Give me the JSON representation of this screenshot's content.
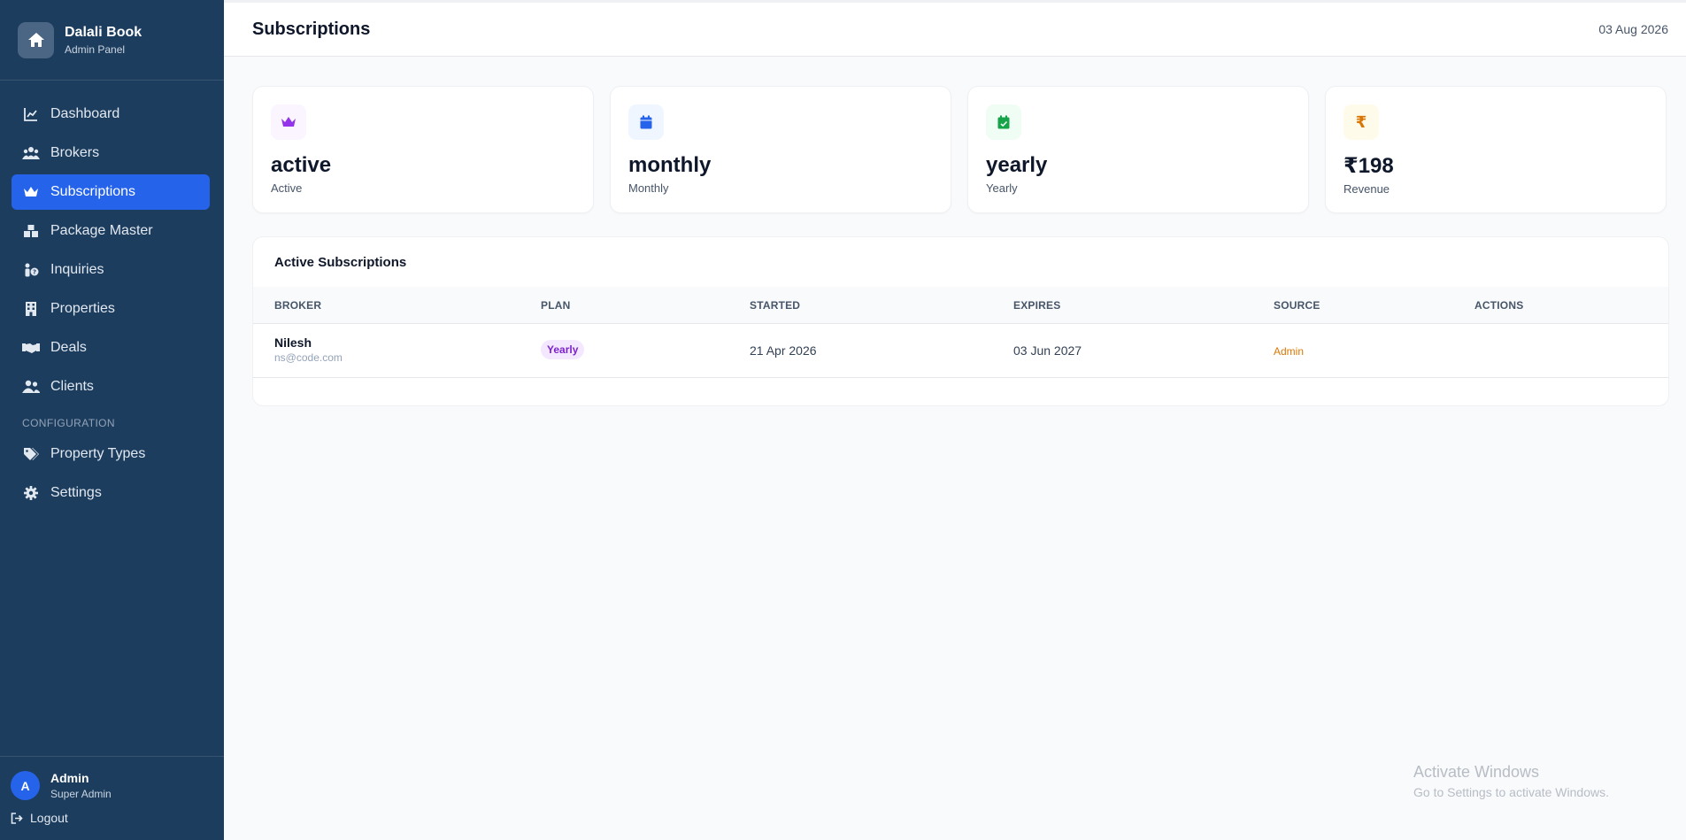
{
  "brand": {
    "title": "Dalali Book",
    "subtitle": "Admin Panel"
  },
  "sidebar": {
    "items": [
      {
        "label": "Dashboard",
        "icon": "chart-line-icon"
      },
      {
        "label": "Brokers",
        "icon": "users-icon"
      },
      {
        "label": "Subscriptions",
        "icon": "crown-icon",
        "active": true
      },
      {
        "label": "Package Master",
        "icon": "boxes-icon"
      },
      {
        "label": "Inquiries",
        "icon": "person-question-icon"
      },
      {
        "label": "Properties",
        "icon": "building-icon"
      },
      {
        "label": "Deals",
        "icon": "handshake-icon"
      },
      {
        "label": "Clients",
        "icon": "user-group-icon"
      }
    ],
    "section_label": "CONFIGURATION",
    "config_items": [
      {
        "label": "Property Types",
        "icon": "tags-icon"
      },
      {
        "label": "Settings",
        "icon": "gear-icon"
      }
    ]
  },
  "user": {
    "initial": "A",
    "name": "Admin",
    "role": "Super Admin",
    "logout_label": "Logout"
  },
  "header": {
    "title": "Subscriptions",
    "date": "03 Aug 2026"
  },
  "stats": [
    {
      "value": "active",
      "label": "Active",
      "icon": "crown-icon",
      "color": "#9333ea",
      "bg": "#faf5ff"
    },
    {
      "value": "monthly",
      "label": "Monthly",
      "icon": "calendar-icon",
      "color": "#2563eb",
      "bg": "#eff6ff"
    },
    {
      "value": "yearly",
      "label": "Yearly",
      "icon": "calendar-check-icon",
      "color": "#16a34a",
      "bg": "#f0fdf4"
    },
    {
      "value": "₹198",
      "label": "Revenue",
      "icon": "rupee-icon",
      "icon_glyph": "₹",
      "color": "#d97706",
      "bg": "#fffbeb"
    }
  ],
  "table": {
    "title": "Active Subscriptions",
    "columns": [
      "BROKER",
      "PLAN",
      "STARTED",
      "EXPIRES",
      "SOURCE",
      "ACTIONS"
    ],
    "rows": [
      {
        "broker_name": "Nilesh",
        "broker_email": "ns@code.com",
        "plan": "Yearly",
        "started": "21 Apr 2026",
        "expires": "03 Jun 2027",
        "source": "Admin"
      }
    ]
  },
  "watermark": {
    "title": "Activate Windows",
    "subtitle": "Go to Settings to activate Windows."
  },
  "colors": {
    "sidebar_bg": "#1c3d5e",
    "accent": "#2563eb",
    "page_bg": "#f8fafc"
  }
}
